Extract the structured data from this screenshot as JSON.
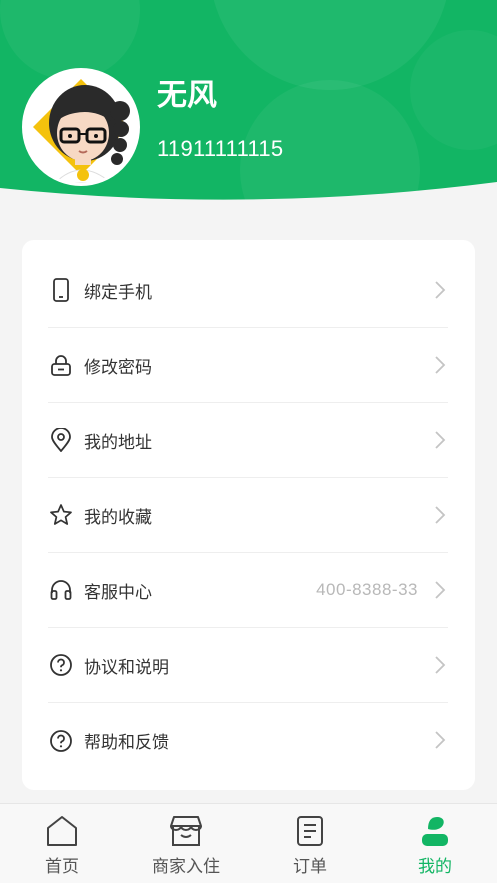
{
  "colors": {
    "brand_green": "#12b564",
    "background": "#f4f4f4",
    "muted_text": "#b8b8b8"
  },
  "profile": {
    "name": "无风",
    "phone": "11911111115",
    "avatar_icon": "cartoon-avatar-icon"
  },
  "menu": [
    {
      "label": "绑定手机",
      "icon": "phone-icon",
      "value": ""
    },
    {
      "label": "修改密码",
      "icon": "lock-icon",
      "value": ""
    },
    {
      "label": "我的地址",
      "icon": "location-icon",
      "value": ""
    },
    {
      "label": "我的收藏",
      "icon": "star-icon",
      "value": ""
    },
    {
      "label": "客服中心",
      "icon": "headset-icon",
      "value": "400-8388-33"
    },
    {
      "label": "协议和说明",
      "icon": "help-circle-icon",
      "value": ""
    },
    {
      "label": "帮助和反馈",
      "icon": "help-circle-icon",
      "value": ""
    }
  ],
  "tabs": [
    {
      "label": "首页",
      "icon": "home-icon",
      "active": false
    },
    {
      "label": "商家入住",
      "icon": "store-icon",
      "active": false
    },
    {
      "label": "订单",
      "icon": "order-icon",
      "active": false
    },
    {
      "label": "我的",
      "icon": "profile-icon",
      "active": true
    }
  ]
}
